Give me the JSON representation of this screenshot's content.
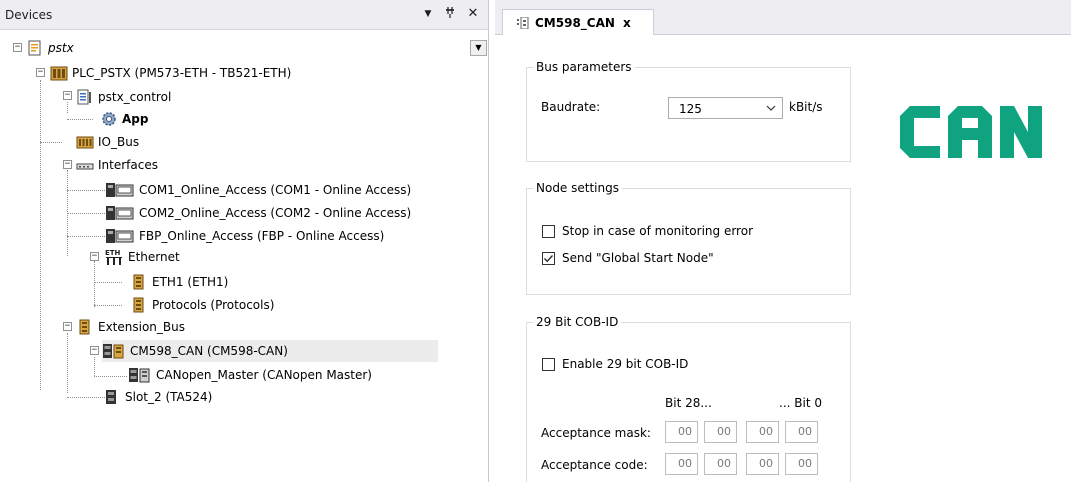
{
  "devices_panel": {
    "title": "Devices",
    "controls": {
      "dropdown": "▼",
      "pin": "ᵽ",
      "close": "✕"
    }
  },
  "tree": {
    "root": "pstx",
    "plc": "PLC_PSTX (PM573-ETH - TB521-ETH)",
    "control": "pstx_control",
    "app": "App",
    "io_bus": "IO_Bus",
    "interfaces": "Interfaces",
    "com1": "COM1_Online_Access (COM1 - Online Access)",
    "com2": "COM2_Online_Access (COM2 - Online Access)",
    "fbp": "FBP_Online_Access (FBP - Online Access)",
    "ethernet": "Ethernet",
    "eth_icon_text": "ETH",
    "eth1": "ETH1 (ETH1)",
    "protocols": "Protocols (Protocols)",
    "extension_bus": "Extension_Bus",
    "cm598": "CM598_CAN (CM598-CAN)",
    "canopen": "CANopen_Master (CANopen Master)",
    "slot2": "Slot_2 (TA524)"
  },
  "editor": {
    "tab_label": "CM598_CAN",
    "tab_close": "x",
    "bus_parameters": {
      "legend": "Bus parameters",
      "baudrate_label": "Baudrate:",
      "baudrate_value": "125",
      "baudrate_unit": "kBit/s"
    },
    "node_settings": {
      "legend": "Node settings",
      "stop_on_error_label": "Stop in case of monitoring error",
      "stop_on_error_checked": false,
      "send_global_start_label": "Send \"Global Start Node\"",
      "send_global_start_checked": true
    },
    "cob_id": {
      "legend": "29 Bit COB-ID",
      "enable_label": "Enable 29 bit COB-ID",
      "enable_checked": false,
      "bit_high": "Bit 28...",
      "bit_low": "... Bit 0",
      "acceptance_mask_label": "Acceptance mask:",
      "acceptance_mask": [
        "00",
        "00",
        "00",
        "00"
      ],
      "acceptance_code_label": "Acceptance code:",
      "acceptance_code": [
        "00",
        "00",
        "00",
        "00"
      ]
    },
    "logo_text": "CAN"
  },
  "colors": {
    "logo_green": "#10a37f",
    "header_bg": "#eeeef2",
    "selection_bg": "#ececec",
    "group_border": "#d5dfe5"
  },
  "icons": {
    "root": "project-file-icon",
    "plc": "plc-device-icon",
    "control": "application-module-icon",
    "app": "gear-app-icon",
    "io_bus": "io-bus-icon",
    "interfaces": "interfaces-icon",
    "com": "serial-port-icon",
    "ethernet": "ethernet-icon",
    "slot": "module-slot-icon",
    "can_tab": "can-module-icon",
    "dropdown": "chevron-down-icon"
  }
}
